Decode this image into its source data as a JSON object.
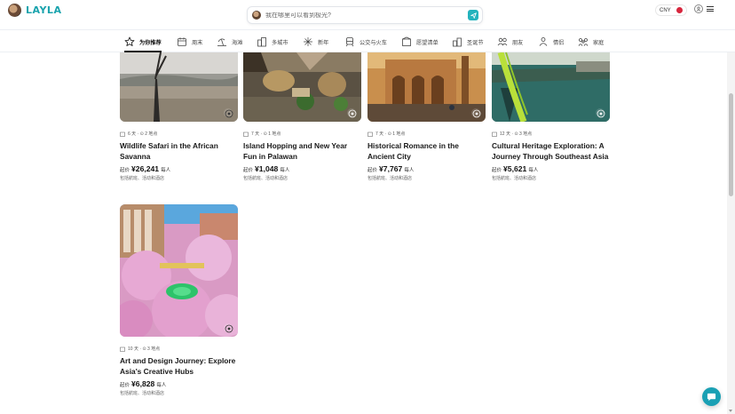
{
  "brand": {
    "name": "LAYLA",
    "color": "#1aa3ad"
  },
  "search": {
    "placeholder": "我在哪里可以看到极光?",
    "send_icon": "send-icon"
  },
  "header": {
    "currency": "CNY",
    "user_icon": "user-icon",
    "menu_icon": "hamburger-icon"
  },
  "categories": [
    {
      "label": "为你推荐",
      "icon": "star-icon",
      "active": true
    },
    {
      "label": "周末",
      "icon": "calendar-icon"
    },
    {
      "label": "海滩",
      "icon": "beach-icon"
    },
    {
      "label": "多城市",
      "icon": "city-icon"
    },
    {
      "label": "新年",
      "icon": "sparkle-icon"
    },
    {
      "label": "公交与火车",
      "icon": "train-icon"
    },
    {
      "label": "愿望清单",
      "icon": "wishlist-icon"
    },
    {
      "label": "圣诞节",
      "icon": "christmas-icon"
    },
    {
      "label": "朋友",
      "icon": "friends-icon"
    },
    {
      "label": "情侣",
      "icon": "couple-icon"
    },
    {
      "label": "家庭",
      "icon": "family-icon"
    }
  ],
  "cards": [
    {
      "meta": "6 天 · ⊙ 2 地点",
      "title": "Wildlife Safari in the African Savanna",
      "price_prefix": "起价",
      "price": "¥26,241",
      "price_suffix": "每人",
      "includes": "包括航班、活动和酒店"
    },
    {
      "meta": "7 天 · ⊙ 1 地点",
      "title": "Island Hopping and New Year Fun in Palawan",
      "price_prefix": "起价",
      "price": "¥1,048",
      "price_suffix": "每人",
      "includes": "包括航班、活动和酒店"
    },
    {
      "meta": "7 天 · ⊙ 1 地点",
      "title": "Historical Romance in the Ancient City",
      "price_prefix": "起价",
      "price": "¥7,767",
      "price_suffix": "每人",
      "includes": "包括航班、活动和酒店"
    },
    {
      "meta": "12 天 · ⊙ 3 地点",
      "title": "Cultural Heritage Exploration: A Journey Through Southeast Asia",
      "price_prefix": "起价",
      "price": "¥5,621",
      "price_suffix": "每人",
      "includes": "包括航班、活动和酒店"
    },
    {
      "meta": "10 天 · ⊙ 3 地点",
      "title": "Art and Design Journey: Explore Asia's Creative Hubs",
      "price_prefix": "起价",
      "price": "¥6,828",
      "price_suffix": "每人",
      "includes": "包括航班、活动和酒店"
    }
  ],
  "chat": {
    "icon": "chat-icon",
    "color": "#1aa0b4"
  }
}
